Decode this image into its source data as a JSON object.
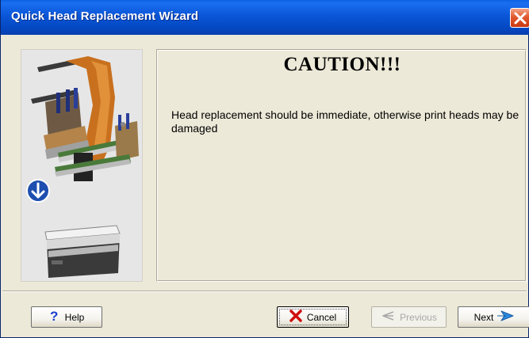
{
  "window": {
    "title": "Quick Head Replacement Wizard",
    "close_icon": "close-icon"
  },
  "content": {
    "heading": "CAUTION!!!",
    "message": "Head replacement should be immediate, otherwise print heads may be damaged"
  },
  "buttons": {
    "help": {
      "label": "Help",
      "icon": "help-question-icon",
      "enabled": true
    },
    "cancel": {
      "label": "Cancel",
      "icon": "red-x-icon",
      "enabled": true,
      "focused": true
    },
    "previous": {
      "label": "Previous",
      "icon": "back-arrow-icon",
      "enabled": false
    },
    "next": {
      "label": "Next",
      "icon": "forward-arrow-icon",
      "enabled": true
    }
  },
  "colors": {
    "titlebar": "#0B56D8",
    "close": "#E2592F",
    "dialog_bg": "#ECE9D8",
    "help_icon": "#1A3FD0",
    "cancel_icon": "#D01010",
    "next_arrow": "#2A8AE0"
  }
}
